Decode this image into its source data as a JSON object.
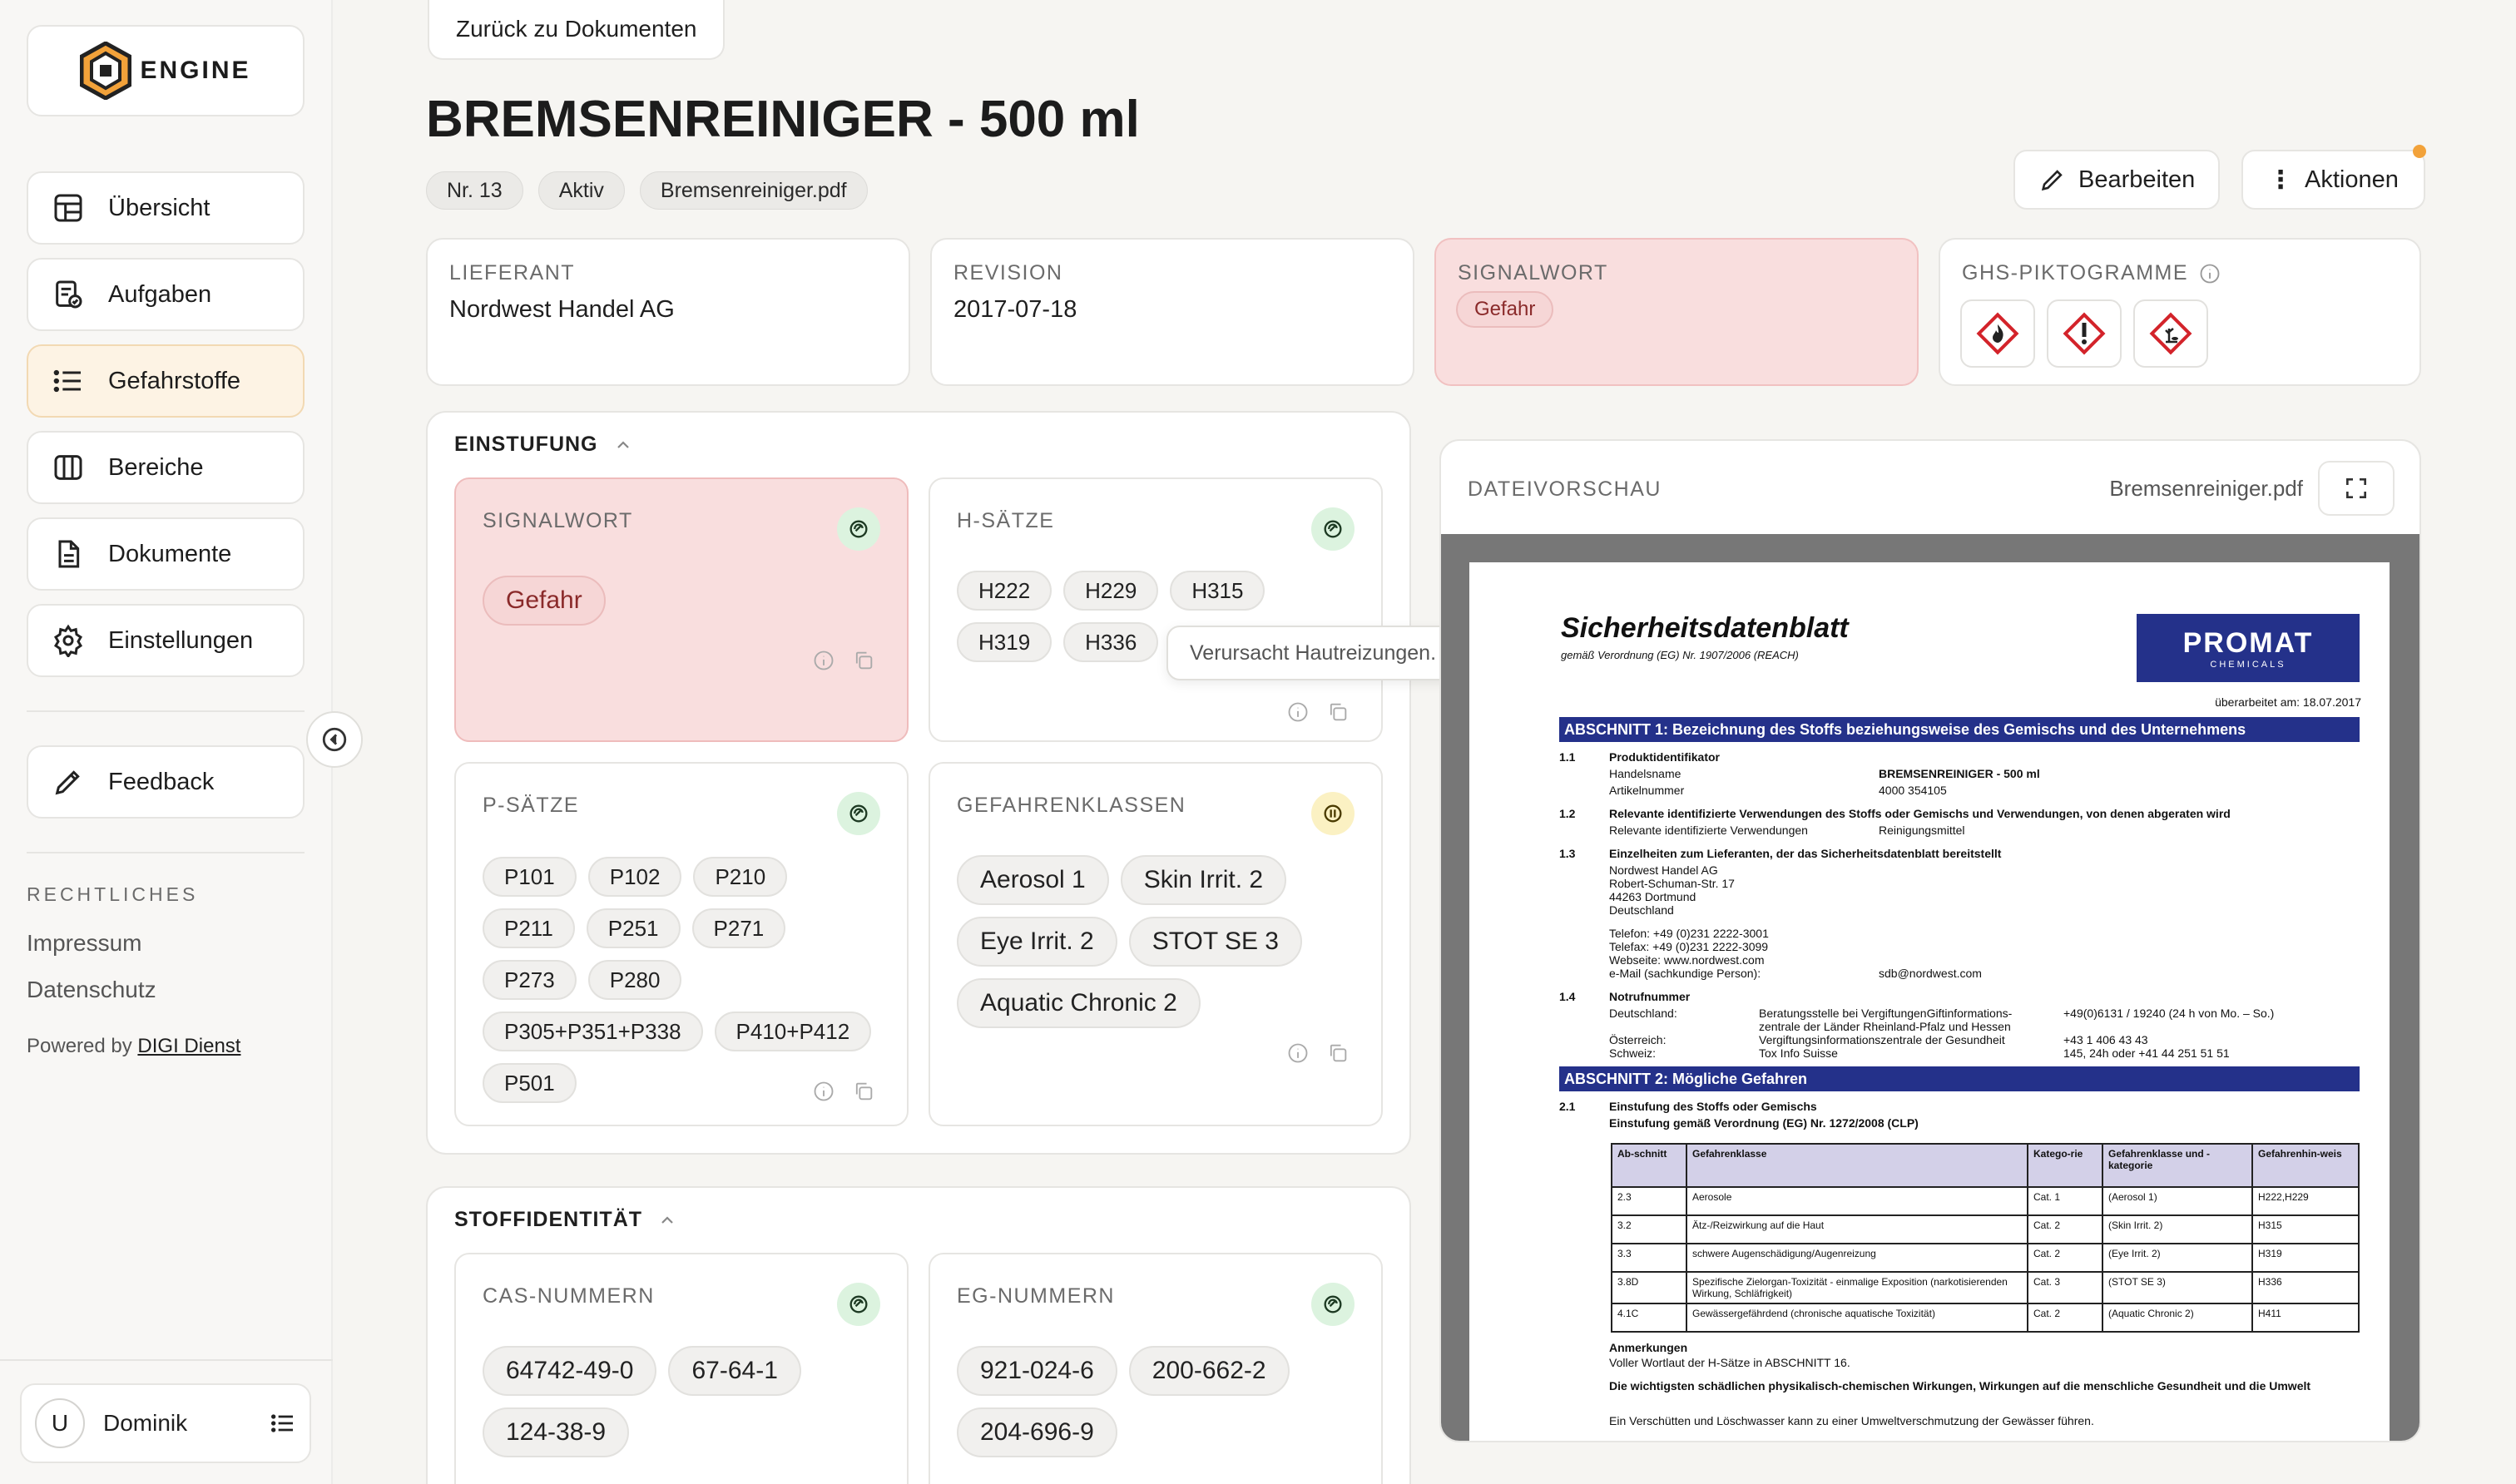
{
  "brand": {
    "name": "ENGINE"
  },
  "sidebar": {
    "items": [
      {
        "label": "Übersicht",
        "icon": "layout-dashboard-icon"
      },
      {
        "label": "Aufgaben",
        "icon": "clipboard-check-icon"
      },
      {
        "label": "Gefahrstoffe",
        "icon": "list-icon",
        "active": true
      },
      {
        "label": "Bereiche",
        "icon": "columns-icon"
      },
      {
        "label": "Dokumente",
        "icon": "file-text-icon"
      },
      {
        "label": "Einstellungen",
        "icon": "gear-icon"
      }
    ],
    "feedback": "Feedback",
    "legal_title": "RECHTLICHES",
    "impressum": "Impressum",
    "datenschutz": "Datenschutz",
    "powered_prefix": "Powered by",
    "powered_link": "DIGI Dienst",
    "user": {
      "initial": "U",
      "name": "Dominik"
    }
  },
  "header": {
    "back": "Zurück zu Dokumenten",
    "title": "BREMSENREINIGER - 500 ml",
    "chips": [
      "Nr. 13",
      "Aktiv",
      "Bremsenreiniger.pdf"
    ],
    "edit": "Bearbeiten",
    "actions": "Aktionen"
  },
  "summary": {
    "lieferant_label": "LIEFERANT",
    "lieferant": "Nordwest Handel AG",
    "revision_label": "REVISION",
    "revision": "2017-07-18",
    "signalwort_label": "SIGNALWORT",
    "signalwort": "Gefahr",
    "ghs_label": "GHS-PIKTOGRAMME",
    "ghs": [
      "flame-pictogram-icon",
      "exclamation-pictogram-icon",
      "environment-pictogram-icon"
    ]
  },
  "einstufung": {
    "title": "EINSTUFUNG",
    "signalwort_label": "SIGNALWORT",
    "signalwort": "Gefahr",
    "h_label": "H-SÄTZE",
    "h": [
      "H222",
      "H229",
      "H315",
      "H319",
      "H336"
    ],
    "tooltip": "Verursacht Hautreizungen.",
    "p_label": "P-SÄTZE",
    "p": [
      "P101",
      "P102",
      "P210",
      "P211",
      "P251",
      "P271",
      "P273",
      "P280",
      "P305+P351+P338",
      "P410+P412",
      "P501"
    ],
    "gk_label": "GEFAHRENKLASSEN",
    "gk": [
      "Aerosol 1",
      "Skin Irrit. 2",
      "Eye Irrit. 2",
      "STOT SE 3",
      "Aquatic Chronic 2"
    ]
  },
  "stoffidentitaet": {
    "title": "STOFFIDENTITÄT",
    "cas_label": "CAS-NUMMERN",
    "cas": [
      "64742-49-0",
      "67-64-1",
      "124-38-9"
    ],
    "eg_label": "EG-NUMMERN",
    "eg": [
      "921-024-6",
      "200-662-2",
      "204-696-9"
    ]
  },
  "preview": {
    "label": "DATEIVORSCHAU",
    "file": "Bremsenreiniger.pdf",
    "doc": {
      "title": "Sicherheitsdatenblatt",
      "subtitle": "gemäß Verordnung (EG) Nr. 1907/2006 (REACH)",
      "logo": "PROMAT",
      "logo_sub": "CHEMICALS",
      "date": "überarbeitet am: 18.07.2017",
      "s1": "ABSCHNITT 1: Bezeichnung des Stoffs beziehungsweise des Gemischs und des Unternehmens",
      "r11n": "1.1",
      "r11h": "Produktidentifikator",
      "r11a_k": "Handelsname",
      "r11a_v": "BREMSENREINIGER - 500 ml",
      "r11b_k": "Artikelnummer",
      "r11b_v": "4000 354105",
      "r12n": "1.2",
      "r12h": "Relevante identifizierte Verwendungen des Stoffs oder Gemischs und Verwendungen, von denen abgeraten wird",
      "r12a_k": "Relevante identifizierte Verwendungen",
      "r12a_v": "Reinigungsmittel",
      "r13n": "1.3",
      "r13h": "Einzelheiten zum Lieferanten, der das Sicherheitsdatenblatt bereitstellt",
      "addr1": "Nordwest Handel AG",
      "addr2": "Robert-Schuman-Str. 17",
      "addr3": "44263 Dortmund",
      "addr4": "Deutschland",
      "tel": "Telefon: +49 (0)231 2222-3001",
      "fax": "Telefax: +49 (0)231 2222-3099",
      "web": "Webseite: www.nordwest.com",
      "mail_k": "e-Mail (sachkundige Person):",
      "mail_v": "sdb@nordwest.com",
      "r14n": "1.4",
      "r14h": "Notrufnummer",
      "de_k": "Deutschland:",
      "de_v": "Beratungsstelle bei VergiftungenGiftinformations-",
      "de_v2": "zentrale der Länder Rheinland-Pfalz und Hessen",
      "de_t": "+49(0)6131 / 19240 (24 h von Mo. – So.)",
      "at_k": "Österreich:",
      "at_v": "Vergiftungsinformationszentrale der Gesundheit",
      "at_t": "+43 1 406 43 43",
      "ch_k": "Schweiz:",
      "ch_v": "Tox Info Suisse",
      "ch_t": "145, 24h oder +41 44 251 51 51",
      "s2": "ABSCHNITT 2: Mögliche Gefahren",
      "r21n": "2.1",
      "r21h": "Einstufung des Stoffs oder Gemischs",
      "r21h2": "Einstufung gemäß Verordnung (EG) Nr. 1272/2008 (CLP)",
      "table_head": [
        "Ab-schnitt",
        "Gefahrenklasse",
        "Katego-rie",
        "Gefahrenklasse und -kategorie",
        "Gefahrenhin-weis"
      ],
      "table_rows": [
        [
          "2.3",
          "Aerosole",
          "Cat. 1",
          "(Aerosol 1)",
          "H222,H229"
        ],
        [
          "3.2",
          "Ätz-/Reizwirkung auf die Haut",
          "Cat. 2",
          "(Skin Irrit. 2)",
          "H315"
        ],
        [
          "3.3",
          "schwere Augenschädigung/Augenreizung",
          "Cat. 2",
          "(Eye Irrit. 2)",
          "H319"
        ],
        [
          "3.8D",
          "Spezifische Zielorgan-Toxizität - einmalige Exposition (narkotisierenden Wirkung, Schläfrigkeit)",
          "Cat. 3",
          "(STOT SE 3)",
          "H336"
        ],
        [
          "4.1C",
          "Gewässergefährdend (chronische aquatische Toxizität)",
          "Cat. 2",
          "(Aquatic Chronic 2)",
          "H411"
        ]
      ],
      "anm_h": "Anmerkungen",
      "anm": "Voller Wortlaut der H-Sätze in ABSCHNITT 16.",
      "w_h": "Die wichtigsten schädlichen physikalisch-chemischen Wirkungen, Wirkungen auf die menschliche Gesundheit und die Umwelt",
      "w": "Ein Verschütten und Löschwasser kann zu einer Umweltverschmutzung der Gewässer führen."
    }
  },
  "colors": {
    "accent": "#f2a23a",
    "danger_bg": "#f9dede",
    "status_ok": "#dcf3df",
    "status_warn": "#fbf1c3",
    "promat": "#24318a"
  }
}
